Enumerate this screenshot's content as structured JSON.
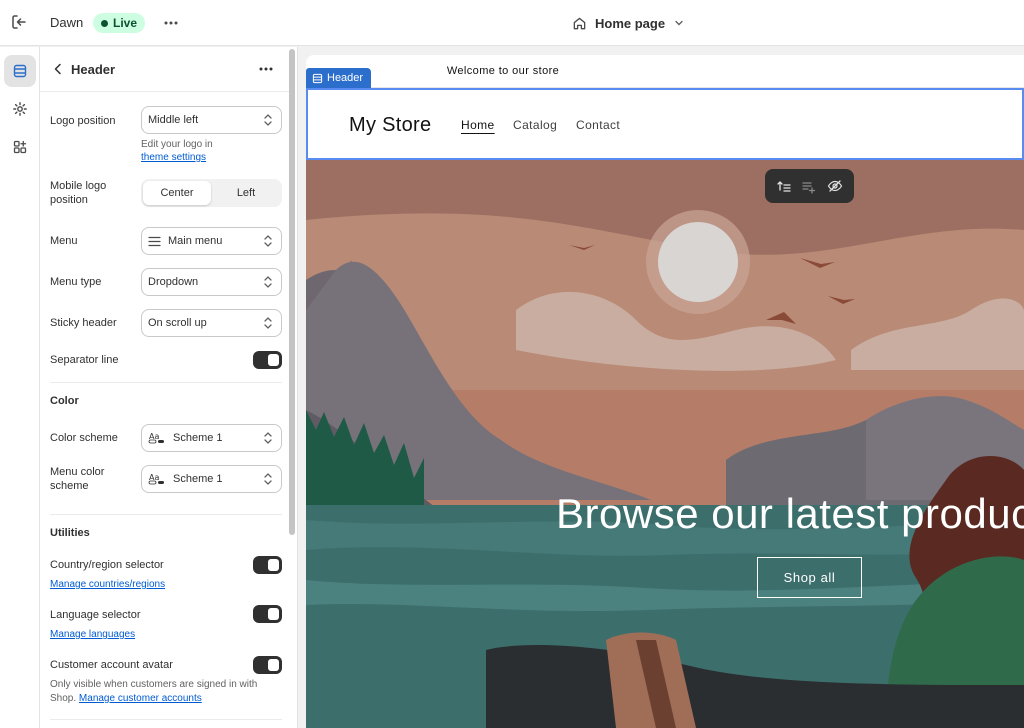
{
  "topbar": {
    "theme_name": "Dawn",
    "live_label": "Live",
    "page_label": "Home page"
  },
  "panel": {
    "title": "Header",
    "logo_position": {
      "label": "Logo position",
      "value": "Middle left"
    },
    "logo_help": {
      "text": "Edit your logo in",
      "link": "theme settings"
    },
    "mobile_logo": {
      "label": "Mobile logo position",
      "options": [
        "Center",
        "Left"
      ],
      "selected": "Center"
    },
    "menu": {
      "label": "Menu",
      "value": "Main menu"
    },
    "menu_type": {
      "label": "Menu type",
      "value": "Dropdown"
    },
    "sticky_header": {
      "label": "Sticky header",
      "value": "On scroll up"
    },
    "separator_line": {
      "label": "Separator line",
      "on": true
    },
    "color_section": "Color",
    "color_scheme": {
      "label": "Color scheme",
      "value": "Scheme 1"
    },
    "menu_color_scheme": {
      "label": "Menu color scheme",
      "value": "Scheme 1"
    },
    "utilities_section": "Utilities",
    "country_selector": {
      "label": "Country/region selector",
      "link": "Manage countries/regions",
      "on": true
    },
    "language_selector": {
      "label": "Language selector",
      "link": "Manage languages",
      "on": true
    },
    "customer_avatar": {
      "label": "Customer account avatar",
      "on": true,
      "note": "Only visible when customers are signed in with Shop.",
      "link": "Manage customer accounts"
    }
  },
  "preview": {
    "announcement": "Welcome to our store",
    "section_tag": "Header",
    "store_name": "My Store",
    "nav": [
      "Home",
      "Catalog",
      "Contact"
    ],
    "hero_title": "Browse our latest products",
    "hero_button": "Shop all"
  },
  "colors": {
    "accent_blue": "#2c6ecb",
    "live_green": "#cdfee1",
    "link": "#005bd3",
    "toggle_on": "#303030"
  }
}
